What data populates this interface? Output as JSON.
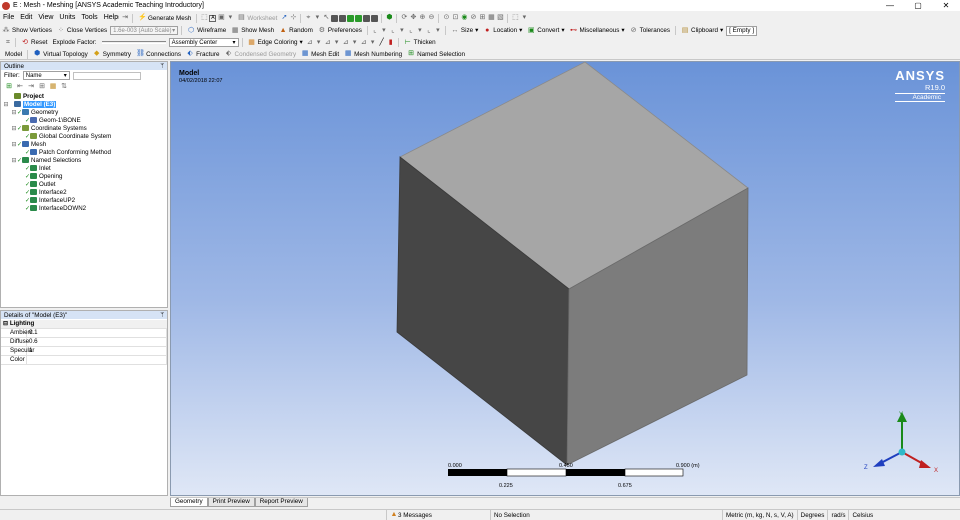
{
  "window": {
    "title": "E : Mesh - Meshing [ANSYS Academic Teaching Introductory]",
    "min": "—",
    "restore": "▢",
    "close": "✕"
  },
  "menu": [
    "File",
    "Edit",
    "View",
    "Units",
    "Tools",
    "Help"
  ],
  "toolbar1": {
    "generate_mesh": "Generate Mesh",
    "worksheet": "Worksheet"
  },
  "toolbar2": {
    "show_vertices": "Show Vertices",
    "close_vertices": "Close Vertices",
    "scale_value": "1.6e-003 (Auto Scale)",
    "wireframe": "Wireframe",
    "show_mesh": "Show Mesh",
    "random": "Random",
    "preferences": "Preferences",
    "size": "Size",
    "location": "Location",
    "convert": "Convert",
    "miscellaneous": "Miscellaneous",
    "tolerances": "Tolerances",
    "clipboard": "Clipboard",
    "empty": "[ Empty ]"
  },
  "toolbar3": {
    "reset": "Reset",
    "explode_factor": "Explode Factor:",
    "assembly_center": "Assembly Center",
    "edge_coloring": "Edge Coloring",
    "thicken": "Thicken"
  },
  "toolbar4": {
    "model": "Model",
    "virtual_topology": "Virtual Topology",
    "symmetry": "Symmetry",
    "connections": "Connections",
    "fracture": "Fracture",
    "condensed_geometry": "Condensed Geometry",
    "mesh_edit": "Mesh Edit",
    "mesh_numbering": "Mesh Numbering",
    "named_selection": "Named Selection"
  },
  "outline": {
    "title": "Outline",
    "pin": "ᛘ",
    "filter_label": "Filter:",
    "filter_value": "Name",
    "tree": [
      {
        "label": "Project",
        "level": 0,
        "exp": "",
        "tick": "",
        "color": "#6a8a2a",
        "bold": true
      },
      {
        "label": "Model (E3)",
        "level": 0,
        "exp": "⊟",
        "tick": "",
        "color": "#3a6aa0",
        "selected": true
      },
      {
        "label": "Geometry",
        "level": 1,
        "exp": "⊟",
        "tick": "✓",
        "color": "#3a7ab0"
      },
      {
        "label": "Geom-1\\BONE",
        "level": 2,
        "exp": "",
        "tick": "✓",
        "color": "#4a6ab0"
      },
      {
        "label": "Coordinate Systems",
        "level": 1,
        "exp": "⊟",
        "tick": "✓",
        "color": "#7a9a3a"
      },
      {
        "label": "Global Coordinate System",
        "level": 2,
        "exp": "",
        "tick": "✓",
        "color": "#7a9a3a"
      },
      {
        "label": "Mesh",
        "level": 1,
        "exp": "⊟",
        "tick": "✓",
        "color": "#3a6ab0"
      },
      {
        "label": "Patch Conforming Method",
        "level": 2,
        "exp": "",
        "tick": "✓",
        "color": "#3a6ab0"
      },
      {
        "label": "Named Selections",
        "level": 1,
        "exp": "⊟",
        "tick": "✓",
        "color": "#2a8a4a"
      },
      {
        "label": "Inlet",
        "level": 2,
        "exp": "",
        "tick": "✓",
        "color": "#2a8a4a"
      },
      {
        "label": "Opening",
        "level": 2,
        "exp": "",
        "tick": "✓",
        "color": "#2a8a4a"
      },
      {
        "label": "Outlet",
        "level": 2,
        "exp": "",
        "tick": "✓",
        "color": "#2a8a4a"
      },
      {
        "label": "Interface2",
        "level": 2,
        "exp": "",
        "tick": "✓",
        "color": "#2a8a4a"
      },
      {
        "label": "InterfaceUP2",
        "level": 2,
        "exp": "",
        "tick": "✓",
        "color": "#2a8a4a"
      },
      {
        "label": "InterfaceDOWN2",
        "level": 2,
        "exp": "",
        "tick": "✓",
        "color": "#2a8a4a"
      }
    ]
  },
  "details": {
    "title": "Details of \"Model (E3)\"",
    "pin": "ᛘ",
    "category": "Lighting",
    "exp": "⊟",
    "rows": [
      {
        "key": "Ambient",
        "value": "0.1"
      },
      {
        "key": "Diffuse",
        "value": "0.6"
      },
      {
        "key": "Specular",
        "value": "1"
      },
      {
        "key": "Color",
        "value": ""
      }
    ]
  },
  "viewport": {
    "title": "Model",
    "date": "04/02/2018 22:07",
    "brand": {
      "name": "ANSYS",
      "version": "R19.0",
      "edition": "Academic"
    },
    "scale": {
      "top_labels": [
        "0.000",
        "0.450",
        "0.900 (m)"
      ],
      "bottom_labels": [
        "0.225",
        "0.675"
      ]
    },
    "axes": {
      "x": "X",
      "y": "Y",
      "z": "Z"
    }
  },
  "tabs": [
    "Geometry",
    "Print Preview",
    "Report Preview"
  ],
  "status": {
    "messages": "3 Messages",
    "selection": "No Selection",
    "units": "Metric (m, kg, N, s, V, A)",
    "degrees": "Degrees",
    "rad": "rad/s",
    "celsius": "Celsius"
  }
}
